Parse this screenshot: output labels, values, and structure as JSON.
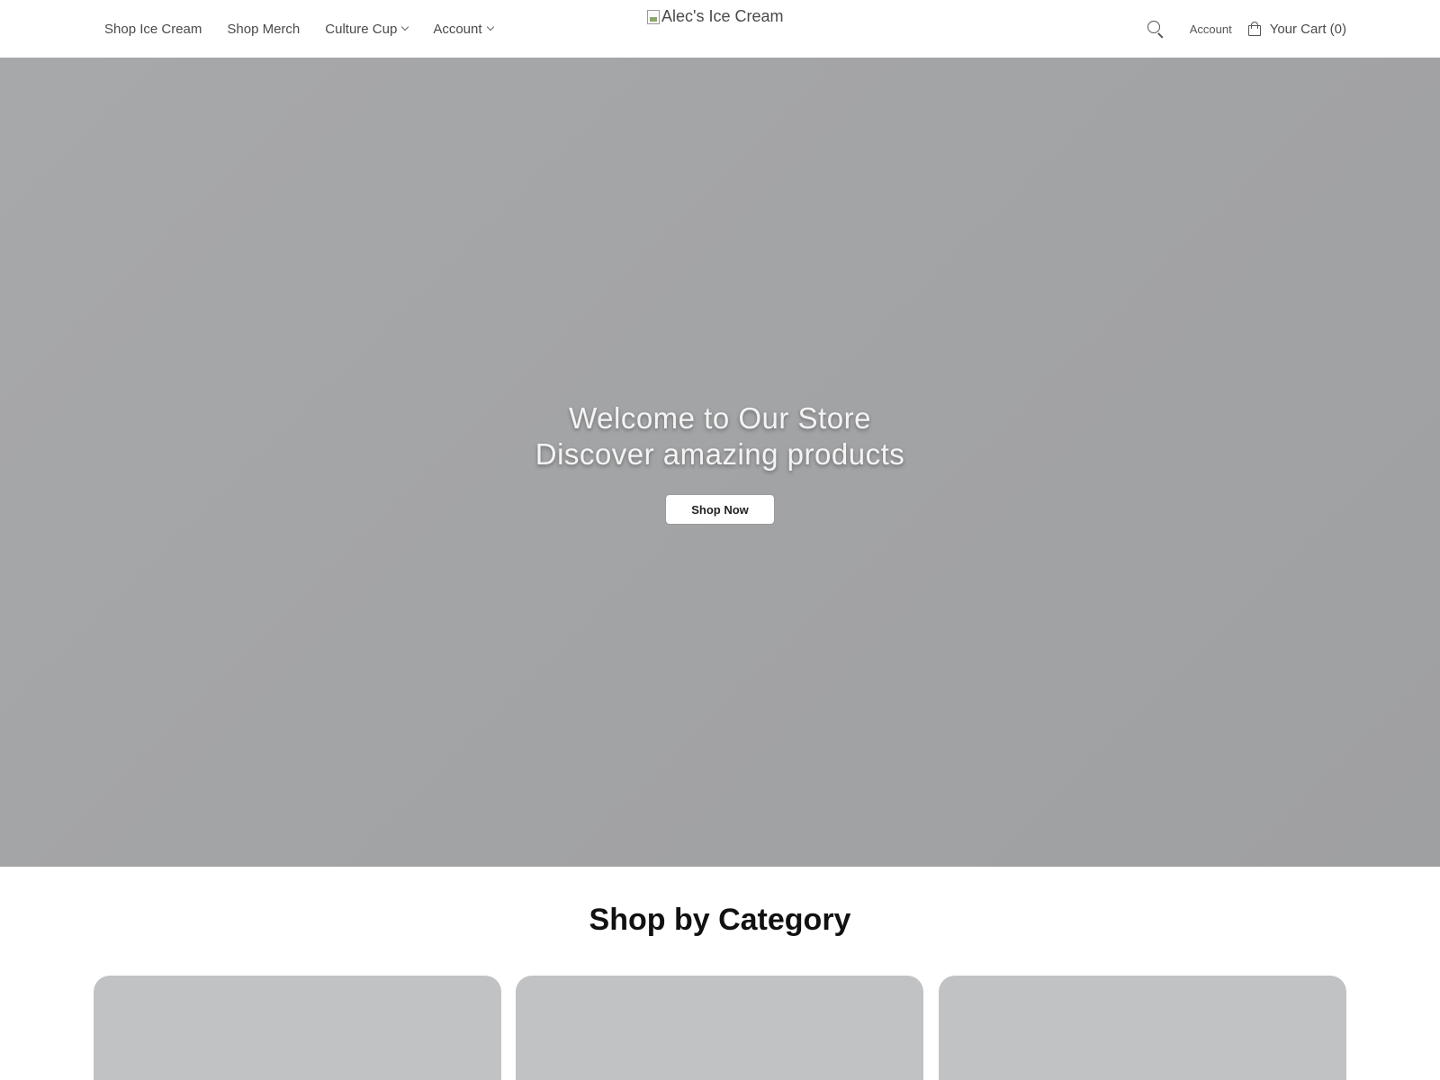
{
  "header": {
    "nav": [
      {
        "label": "Shop Ice Cream",
        "has_dropdown": false
      },
      {
        "label": "Shop Merch",
        "has_dropdown": false
      },
      {
        "label": "Culture Cup",
        "has_dropdown": true
      },
      {
        "label": "Account",
        "has_dropdown": true
      }
    ],
    "logo_alt": "Alec's Ice Cream",
    "account_label": "Account",
    "cart_label": "Your Cart (0)"
  },
  "hero": {
    "line1": "Welcome to Our Store",
    "line2": "Discover amazing products",
    "button_label": "Shop Now"
  },
  "categories": {
    "title": "Shop by Category",
    "cards": [
      {},
      {},
      {}
    ]
  },
  "icons": {
    "search": "search-icon",
    "cart": "shopping-bag-icon",
    "dropdown": "chevron-down-icon",
    "logo": "broken-image-icon"
  },
  "colors": {
    "hero_bg": "#a4a5a7",
    "card_bg": "#c1c2c4",
    "button_bg": "#ffffff"
  }
}
